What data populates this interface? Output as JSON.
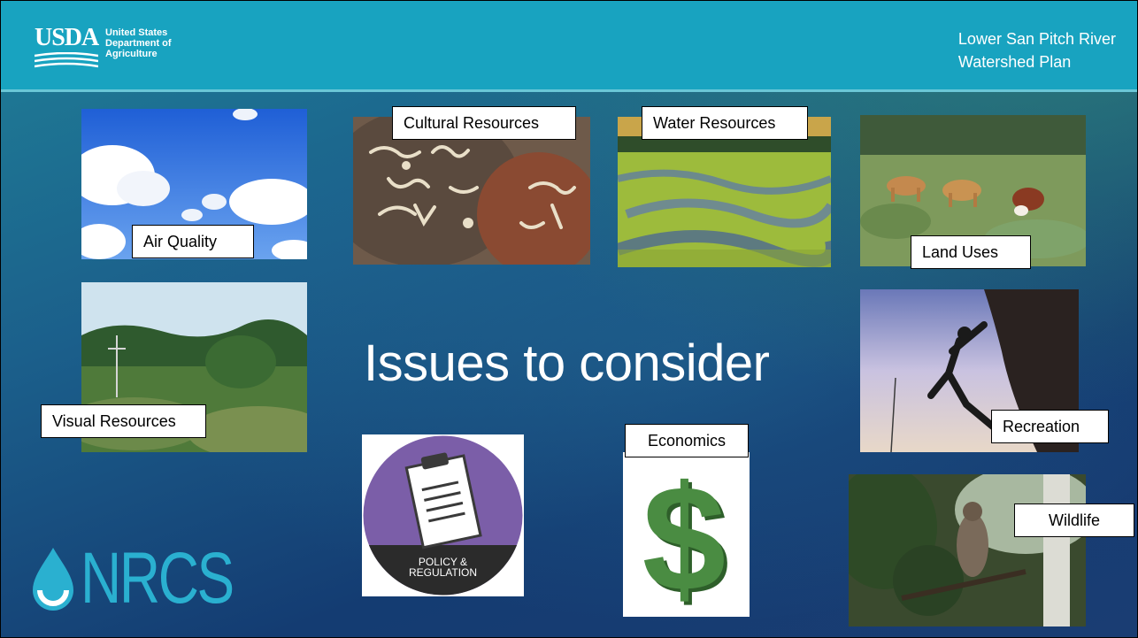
{
  "header": {
    "logo_word": "USDA",
    "logo_line1": "United States",
    "logo_line2": "Department of",
    "logo_line3": "Agriculture",
    "title_line1": "Lower San Pitch River",
    "title_line2": "Watershed Plan"
  },
  "main_title": "Issues to consider",
  "labels": {
    "air_quality": "Air Quality",
    "cultural_resources": "Cultural Resources",
    "water_resources": "Water Resources",
    "land_uses": "Land Uses",
    "visual_resources": "Visual Resources",
    "recreation": "Recreation",
    "economics": "Economics",
    "wildlife": "Wildlife"
  },
  "policy_badge": {
    "line1": "POLICY &",
    "line2": "REGULATION"
  },
  "footer_logo": {
    "word": "NRCS"
  },
  "colors": {
    "header_bg": "#18a3c0",
    "nrcs_blue": "#2ab0d0",
    "policy_purple": "#7b5ea8",
    "dollar_green": "#3f7f3a"
  }
}
